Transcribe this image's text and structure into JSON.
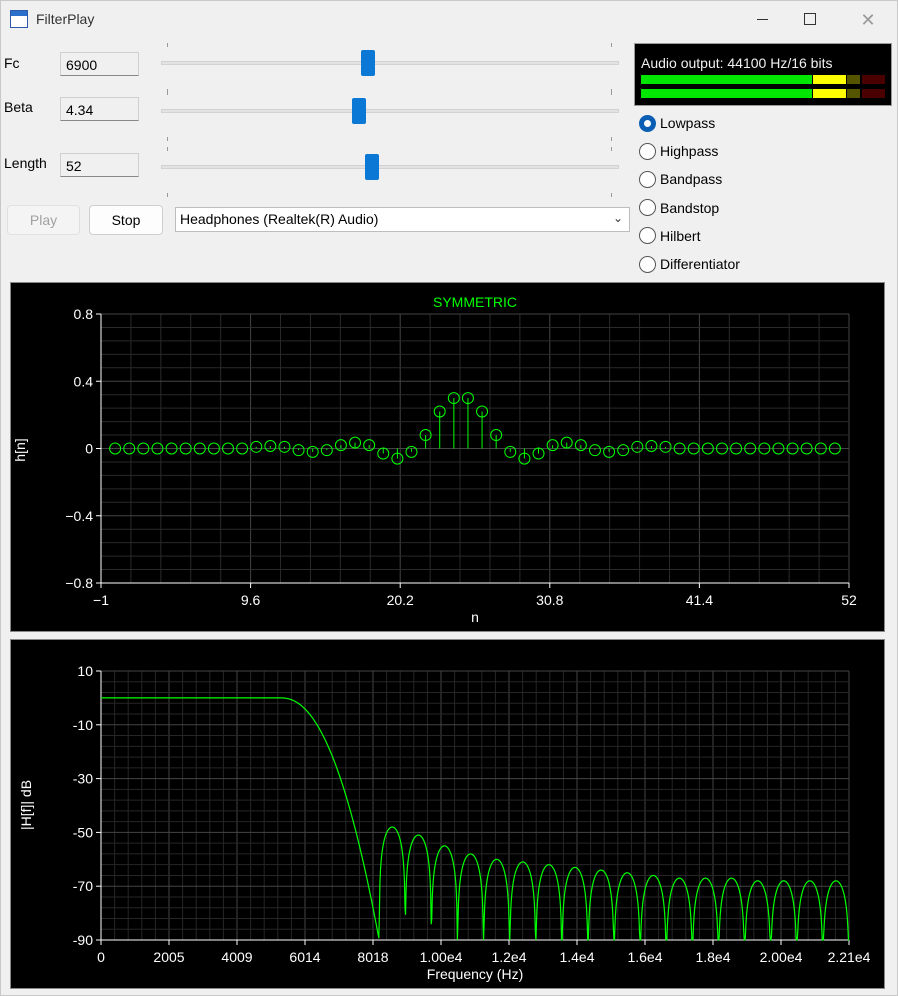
{
  "window": {
    "title": "FilterPlay"
  },
  "params": {
    "fc": {
      "label": "Fc",
      "value": "6900",
      "slider_fraction": 0.45
    },
    "beta": {
      "label": "Beta",
      "value": "4.34",
      "slider_fraction": 0.43
    },
    "length": {
      "label": "Length",
      "value": "52",
      "slider_fraction": 0.46
    }
  },
  "buttons": {
    "play": "Play",
    "stop": "Stop"
  },
  "device": {
    "selected": "Headphones (Realtek(R) Audio)"
  },
  "meter": {
    "label": "Audio output: 44100 Hz/16 bits",
    "left_level": 0.84,
    "right_level": 0.84,
    "colors": {
      "green": "#00e600",
      "yellow": "#ffff00",
      "olive": "#555500",
      "dark_red": "#4a0000"
    }
  },
  "filter_types": [
    {
      "label": "Lowpass",
      "checked": true
    },
    {
      "label": "Highpass",
      "checked": false
    },
    {
      "label": "Bandpass",
      "checked": false
    },
    {
      "label": "Bandstop",
      "checked": false
    },
    {
      "label": "Hilbert",
      "checked": false
    },
    {
      "label": "Differentiator",
      "checked": false
    }
  ],
  "chart_data": [
    {
      "type": "scatter",
      "style": "stem",
      "title": "SYMMETRIC",
      "xlabel": "n",
      "ylabel": "h[n]",
      "xlim": [
        -1,
        52
      ],
      "ylim": [
        -0.8,
        0.8
      ],
      "x_ticks": [
        "−1",
        "9.6",
        "20.2",
        "30.8",
        "41.4",
        "52"
      ],
      "y_ticks": [
        "0.8",
        "0.4",
        "0",
        "−0.4",
        "−0.8"
      ],
      "color": "#00ff00",
      "x": [
        0,
        1,
        2,
        3,
        4,
        5,
        6,
        7,
        8,
        9,
        10,
        11,
        12,
        13,
        14,
        15,
        16,
        17,
        18,
        19,
        20,
        21,
        22,
        23,
        24,
        25,
        26,
        27,
        28,
        29,
        30,
        31,
        32,
        33,
        34,
        35,
        36,
        37,
        38,
        39,
        40,
        41,
        42,
        43,
        44,
        45,
        46,
        47,
        48,
        49,
        50,
        51
      ],
      "y": [
        0,
        0,
        0,
        0,
        0,
        0,
        0,
        0,
        0,
        0,
        0.01,
        0.015,
        0.01,
        -0.01,
        -0.02,
        -0.01,
        0.02,
        0.035,
        0.02,
        -0.03,
        -0.06,
        -0.02,
        0.08,
        0.22,
        0.3,
        0.3,
        0.22,
        0.08,
        -0.02,
        -0.06,
        -0.03,
        0.02,
        0.035,
        0.02,
        -0.01,
        -0.02,
        -0.01,
        0.01,
        0.015,
        0.01,
        0,
        0,
        0,
        0,
        0,
        0,
        0,
        0,
        0,
        0,
        0,
        0
      ]
    },
    {
      "type": "line",
      "title": "",
      "xlabel": "Frequency (Hz)",
      "ylabel": "|H[f]| dB",
      "xlim": [
        0,
        22050
      ],
      "ylim": [
        -90,
        10
      ],
      "x_ticks": [
        "0",
        "2005",
        "4009",
        "6014",
        "8018",
        "1.00e4",
        "1.2e4",
        "1.4e4",
        "1.6e4",
        "1.8e4",
        "2.00e4",
        "2.21e4"
      ],
      "y_ticks": [
        "10",
        "-10",
        "-30",
        "-50",
        "-70",
        "-90"
      ],
      "color": "#00ff00",
      "passband_db": 0,
      "cutoff_hz": 6900,
      "stopband_peaks_db": [
        -48,
        -51,
        -55,
        -58,
        -60,
        -61,
        -62,
        -63,
        -64,
        -65,
        -66,
        -67,
        -67,
        -67,
        -68,
        -68,
        -68,
        -68
      ]
    }
  ]
}
